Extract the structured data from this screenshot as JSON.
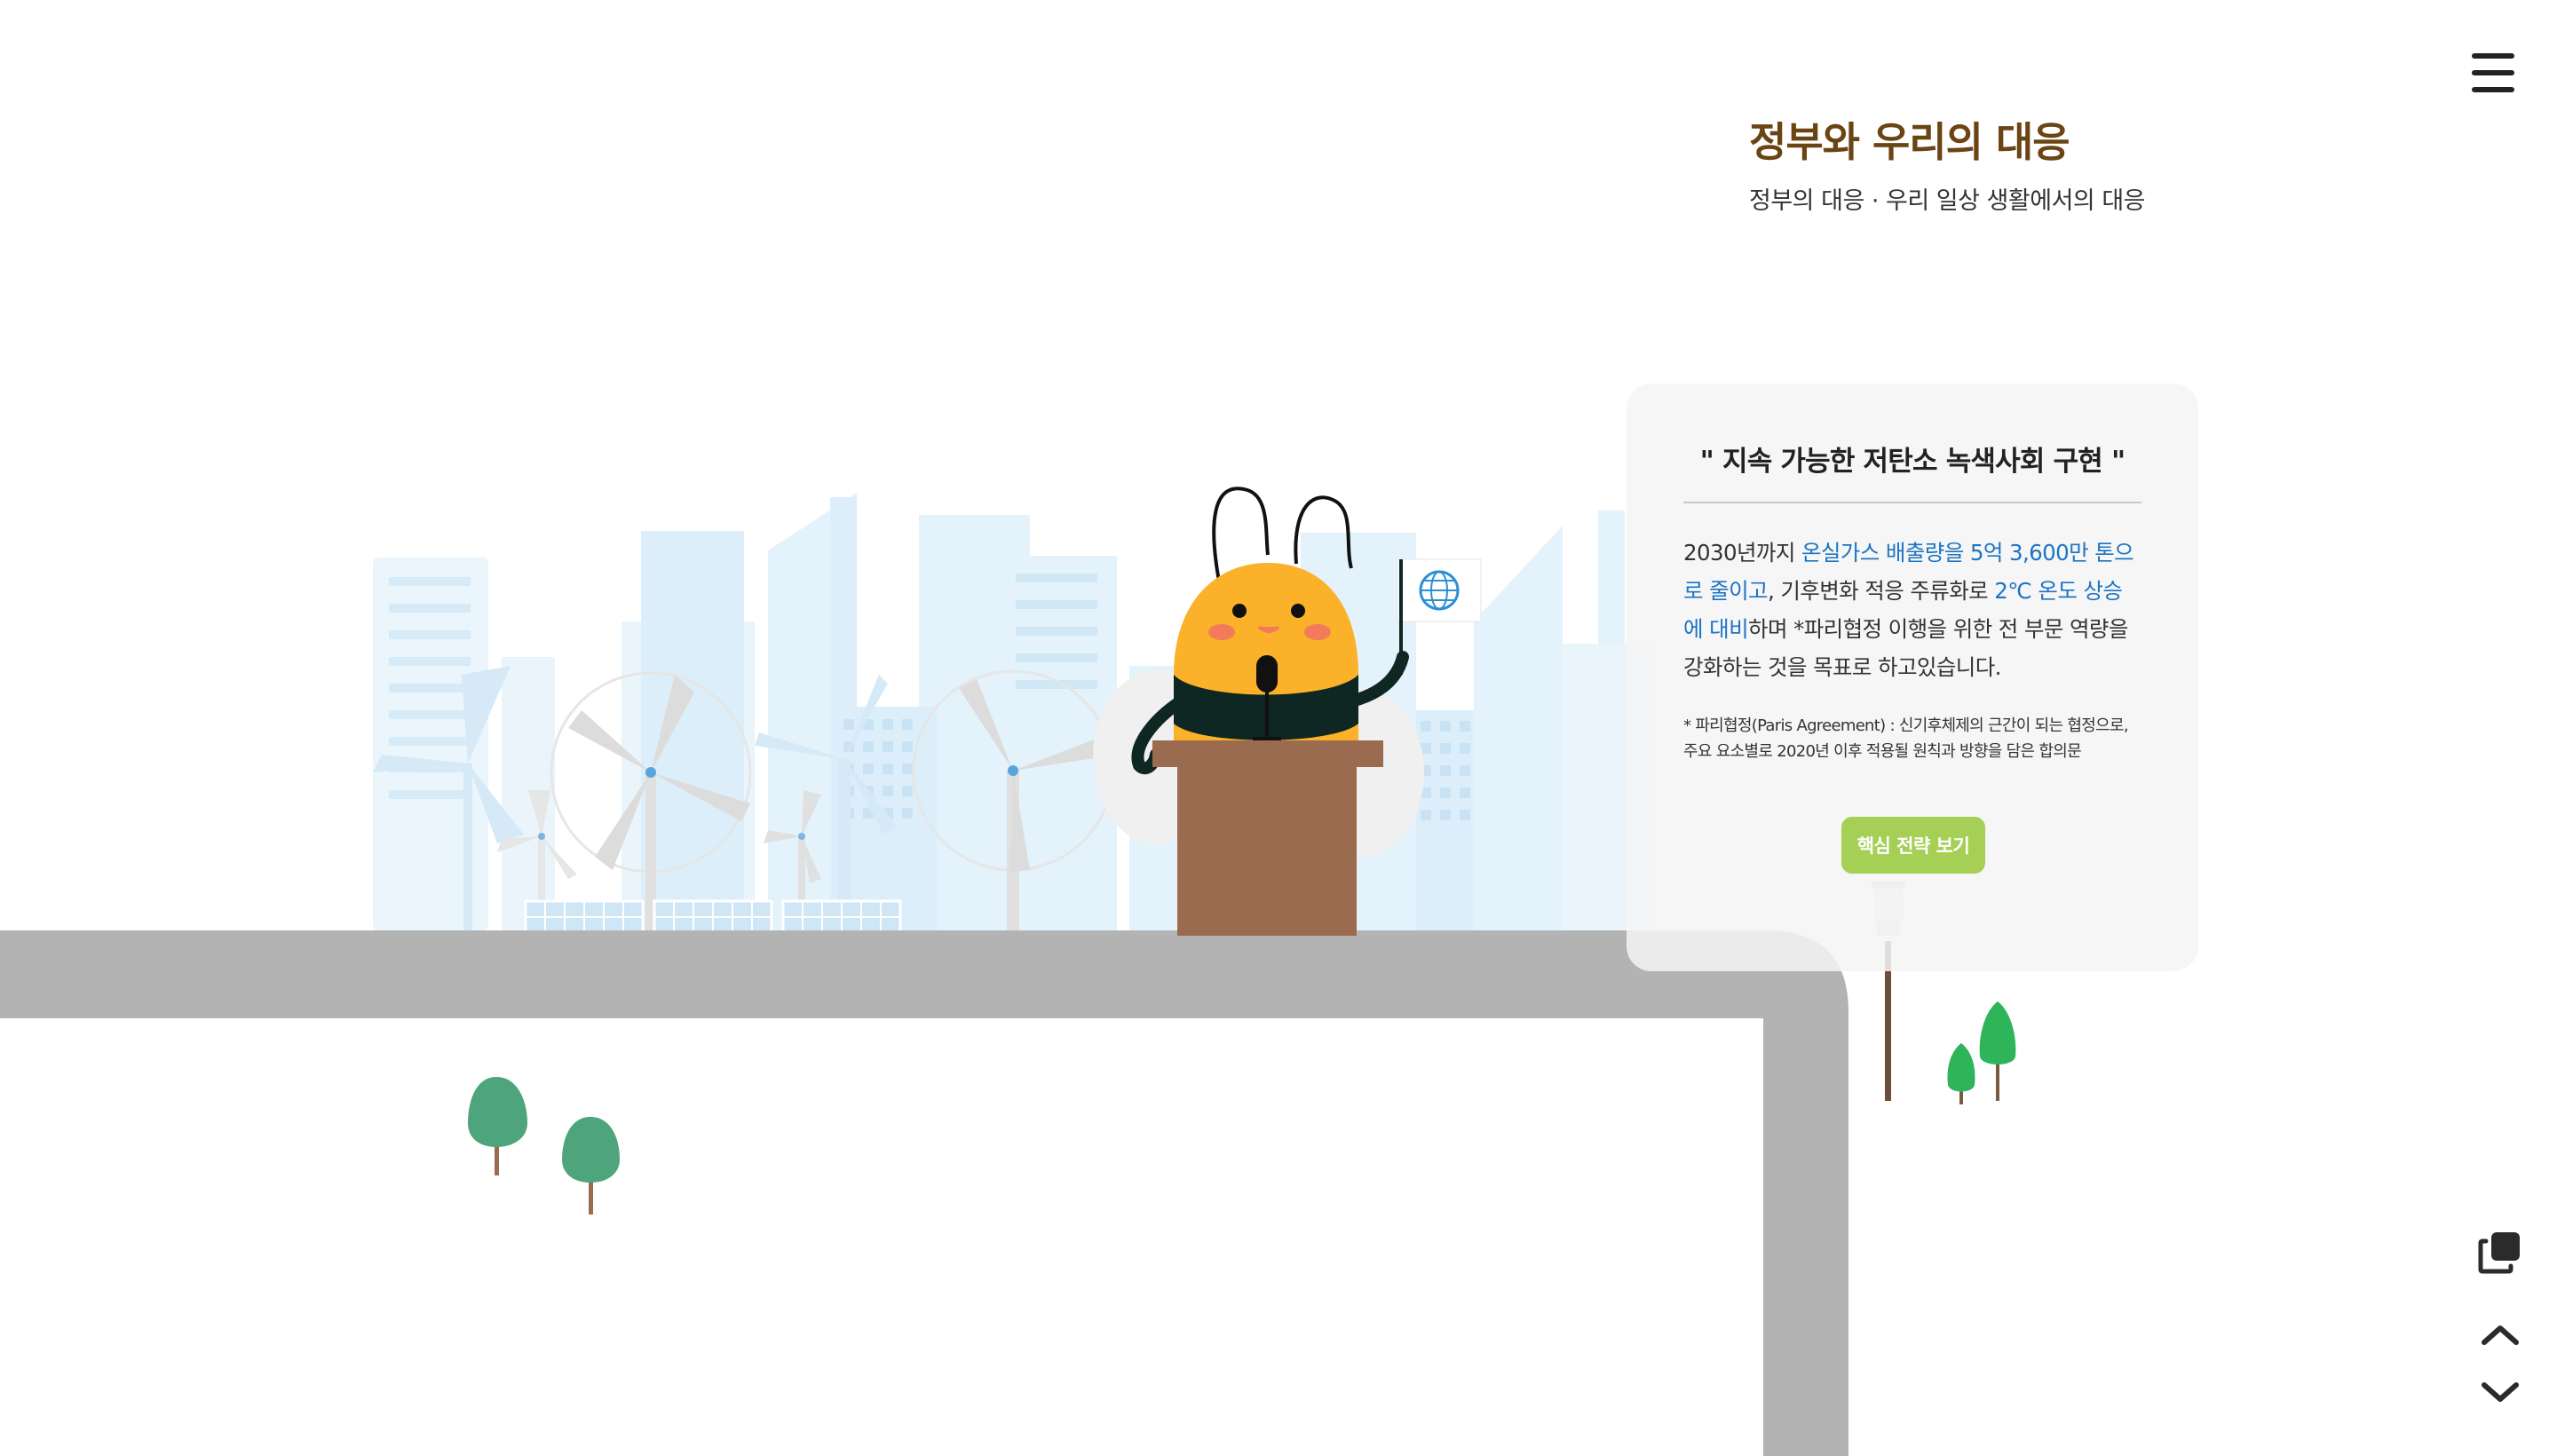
{
  "header": {
    "title": "정부와 우리의 대응",
    "subtitle": "정부의 대응 · 우리 일상 생활에서의 대응",
    "menu_icon": "hamburger-menu-icon"
  },
  "card": {
    "quote": "\" 지속 가능한 저탄소 녹색사회 구현 \"",
    "body": {
      "t1": "2030년까지 ",
      "h1": "온실가스 배출량을 5억 3,600만 톤으로 줄이고",
      "t2": ", 기후변화 적응 주류화로 ",
      "h2": "2℃ 온도 상승에 대비",
      "t3": "하며 *파리협정 이행을 위한 전 부문 역량을 강화하는 것을 목표로 하고있습니다."
    },
    "note": "* 파리협정(Paris Agreement) : 신기후체제의 근간이 되는 협정으로, 주요 요소별로 2020년 이후 적용될 원칙과 방향을 담은 합의문",
    "button_label": "핵심 전략 보기"
  },
  "controls": {
    "copy_icon": "copy-icon",
    "up_icon": "chevron-up-icon",
    "down_icon": "chevron-down-icon"
  },
  "colors": {
    "title": "#6b4414",
    "highlight": "#1c74c4",
    "button": "#a6cf55",
    "road": "#b3b3b3",
    "building": "#e4f2fb",
    "bee_body": "#fbb12a",
    "podium": "#9b6b50"
  }
}
